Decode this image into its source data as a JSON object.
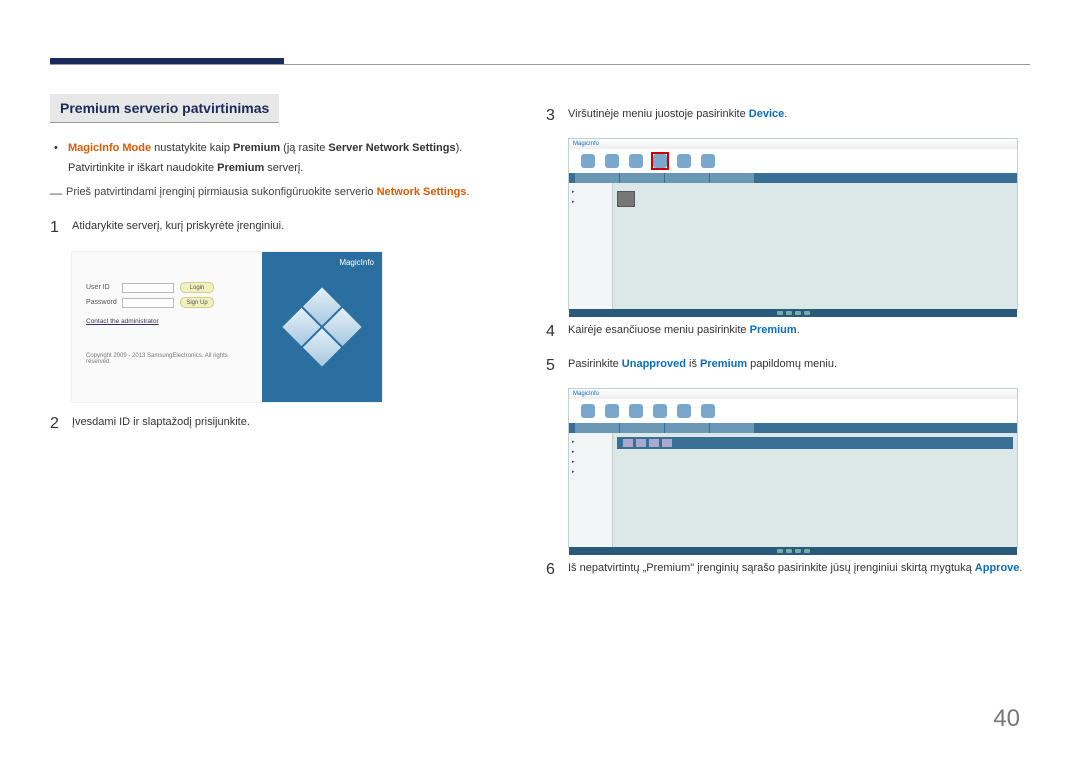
{
  "page_number": "40",
  "title": "Premium serverio patvirtinimas",
  "bullet": {
    "pre": "MagicInfo Mode",
    "mid1": " nustatykite kaip ",
    "mid_bold1": "Premium",
    "mid2": " (ją rasite ",
    "mid_bold2": "Server Network Settings",
    "mid3": ").",
    "line2_pre": "Patvirtinkite ir iškart naudokite ",
    "line2_bold": "Premium",
    "line2_post": " serverį."
  },
  "dash": {
    "pre": "Prieš patvirtindami įrenginį pirmiausia sukonfigūruokite serverio ",
    "link": "Network Settings",
    "post": "."
  },
  "steps": {
    "s1": "Atidarykite serverį, kurį priskyrėte įrenginiui.",
    "s2": "Įvesdami ID ir slaptažodį prisijunkite.",
    "s3_pre": "Viršutinėje meniu juostoje pasirinkite ",
    "s3_link": "Device",
    "s3_post": ".",
    "s4_pre": "Kairėje esančiuose meniu pasirinkite ",
    "s4_link": "Premium",
    "s4_post": ".",
    "s5_pre": "Pasirinkite ",
    "s5_link": "Unapproved",
    "s5_mid": " iš ",
    "s5_link2": "Premium",
    "s5_post": " papildomų meniu.",
    "s6_pre": "Iš nepatvirtintų „Premium\" įrenginių sąrašo pasirinkite jūsų įrenginiui skirtą mygtuką ",
    "s6_link": "Approve",
    "s6_post": "."
  },
  "step_numbers": {
    "s1": "1",
    "s2": "2",
    "s3": "3",
    "s4": "4",
    "s5": "5",
    "s6": "6"
  },
  "login": {
    "userid": "User ID",
    "password": "Password",
    "login_btn": "Login",
    "signup_btn": "Sign Up",
    "contact": "Contact the administrator",
    "copyright": "Copyright 2009 - 2013 SamsungElectronics. All rights reserved.",
    "brand": "MagicInfo"
  },
  "app": {
    "brand": "MagicInfo"
  }
}
